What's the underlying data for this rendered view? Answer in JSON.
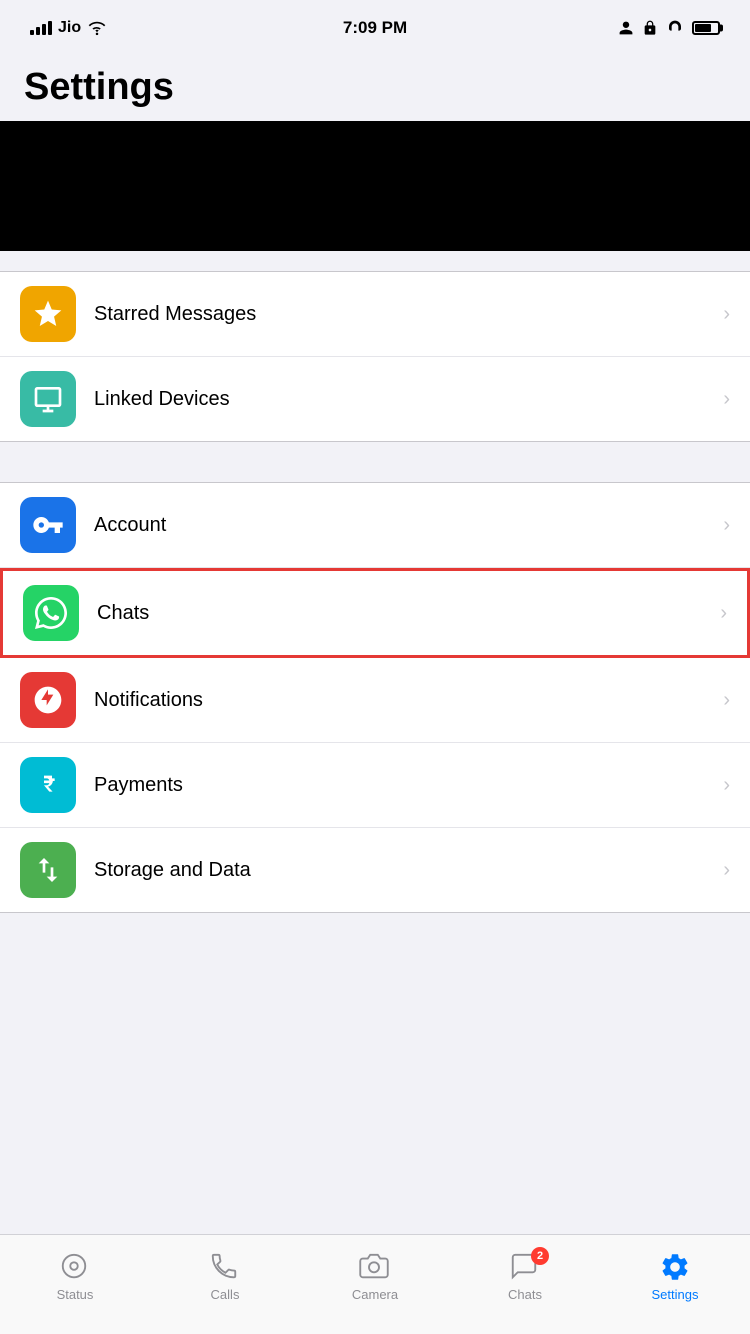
{
  "statusBar": {
    "carrier": "Jio",
    "time": "7:09 PM"
  },
  "page": {
    "title": "Settings"
  },
  "sections": [
    {
      "id": "section1",
      "items": [
        {
          "id": "starred-messages",
          "label": "Starred Messages",
          "iconBg": "#f0a500",
          "iconType": "star",
          "highlighted": false
        },
        {
          "id": "linked-devices",
          "label": "Linked Devices",
          "iconBg": "#38bba5",
          "iconType": "desktop",
          "highlighted": false
        }
      ]
    },
    {
      "id": "section2",
      "items": [
        {
          "id": "account",
          "label": "Account",
          "iconBg": "#1a73e8",
          "iconType": "key",
          "highlighted": false
        },
        {
          "id": "chats",
          "label": "Chats",
          "iconBg": "#25d366",
          "iconType": "whatsapp",
          "highlighted": true
        },
        {
          "id": "notifications",
          "label": "Notifications",
          "iconBg": "#e53935",
          "iconType": "bell",
          "highlighted": false
        },
        {
          "id": "payments",
          "label": "Payments",
          "iconBg": "#00bcd4",
          "iconType": "rupee",
          "highlighted": false
        },
        {
          "id": "storage-data",
          "label": "Storage and Data",
          "iconBg": "#4caf50",
          "iconType": "arrows",
          "highlighted": false
        }
      ]
    }
  ],
  "tabBar": {
    "items": [
      {
        "id": "status",
        "label": "Status",
        "icon": "status",
        "active": false,
        "badge": 0
      },
      {
        "id": "calls",
        "label": "Calls",
        "icon": "calls",
        "active": false,
        "badge": 0
      },
      {
        "id": "camera",
        "label": "Camera",
        "icon": "camera",
        "active": false,
        "badge": 0
      },
      {
        "id": "chats",
        "label": "Chats",
        "icon": "chats",
        "active": false,
        "badge": 2
      },
      {
        "id": "settings",
        "label": "Settings",
        "icon": "settings",
        "active": true,
        "badge": 0
      }
    ]
  }
}
